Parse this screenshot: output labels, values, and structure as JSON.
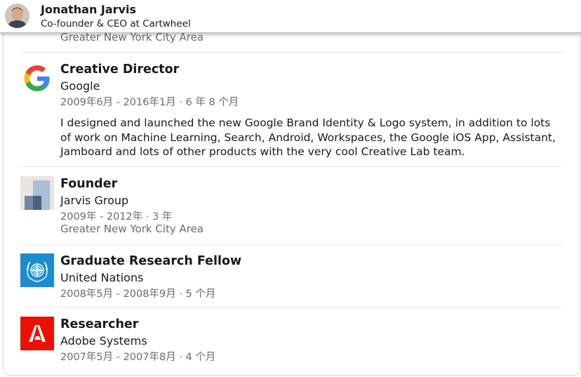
{
  "profile": {
    "name": "Jonathan Jarvis",
    "headline": "Co-founder & CEO at Cartwheel"
  },
  "previous_entry": {
    "location": "Greater New York City Area"
  },
  "experience": [
    {
      "title": "Creative Director",
      "company": "Google",
      "dates": "2009年6月 - 2016年1月 · 6 年 8 个月",
      "description": "I designed and launched the new Google Brand Identity & Logo system, in addition to lots of work on Machine Learning, Search, Android, Workspaces, the Google iOS App, Assistant, Jamboard and lots of other products with the very cool Creative Lab team.",
      "logo": "google-logo-icon"
    },
    {
      "title": "Founder",
      "company": "Jarvis Group",
      "dates": "2009年 - 2012年 · 3 年",
      "location": "Greater New York City Area",
      "logo": "jarvis-group-logo-icon"
    },
    {
      "title": "Graduate Research Fellow",
      "company": "United Nations",
      "dates": "2008年5月 - 2008年9月 · 5 个月",
      "logo": "united-nations-logo-icon"
    },
    {
      "title": "Researcher",
      "company": "Adobe Systems",
      "dates": "2007年5月 - 2007年8月 · 4 个月",
      "logo": "adobe-logo-icon"
    }
  ],
  "colors": {
    "un_blue": "#1a8ccf",
    "adobe_red": "#eb1000",
    "secondary_text": "#6b6b6b"
  }
}
